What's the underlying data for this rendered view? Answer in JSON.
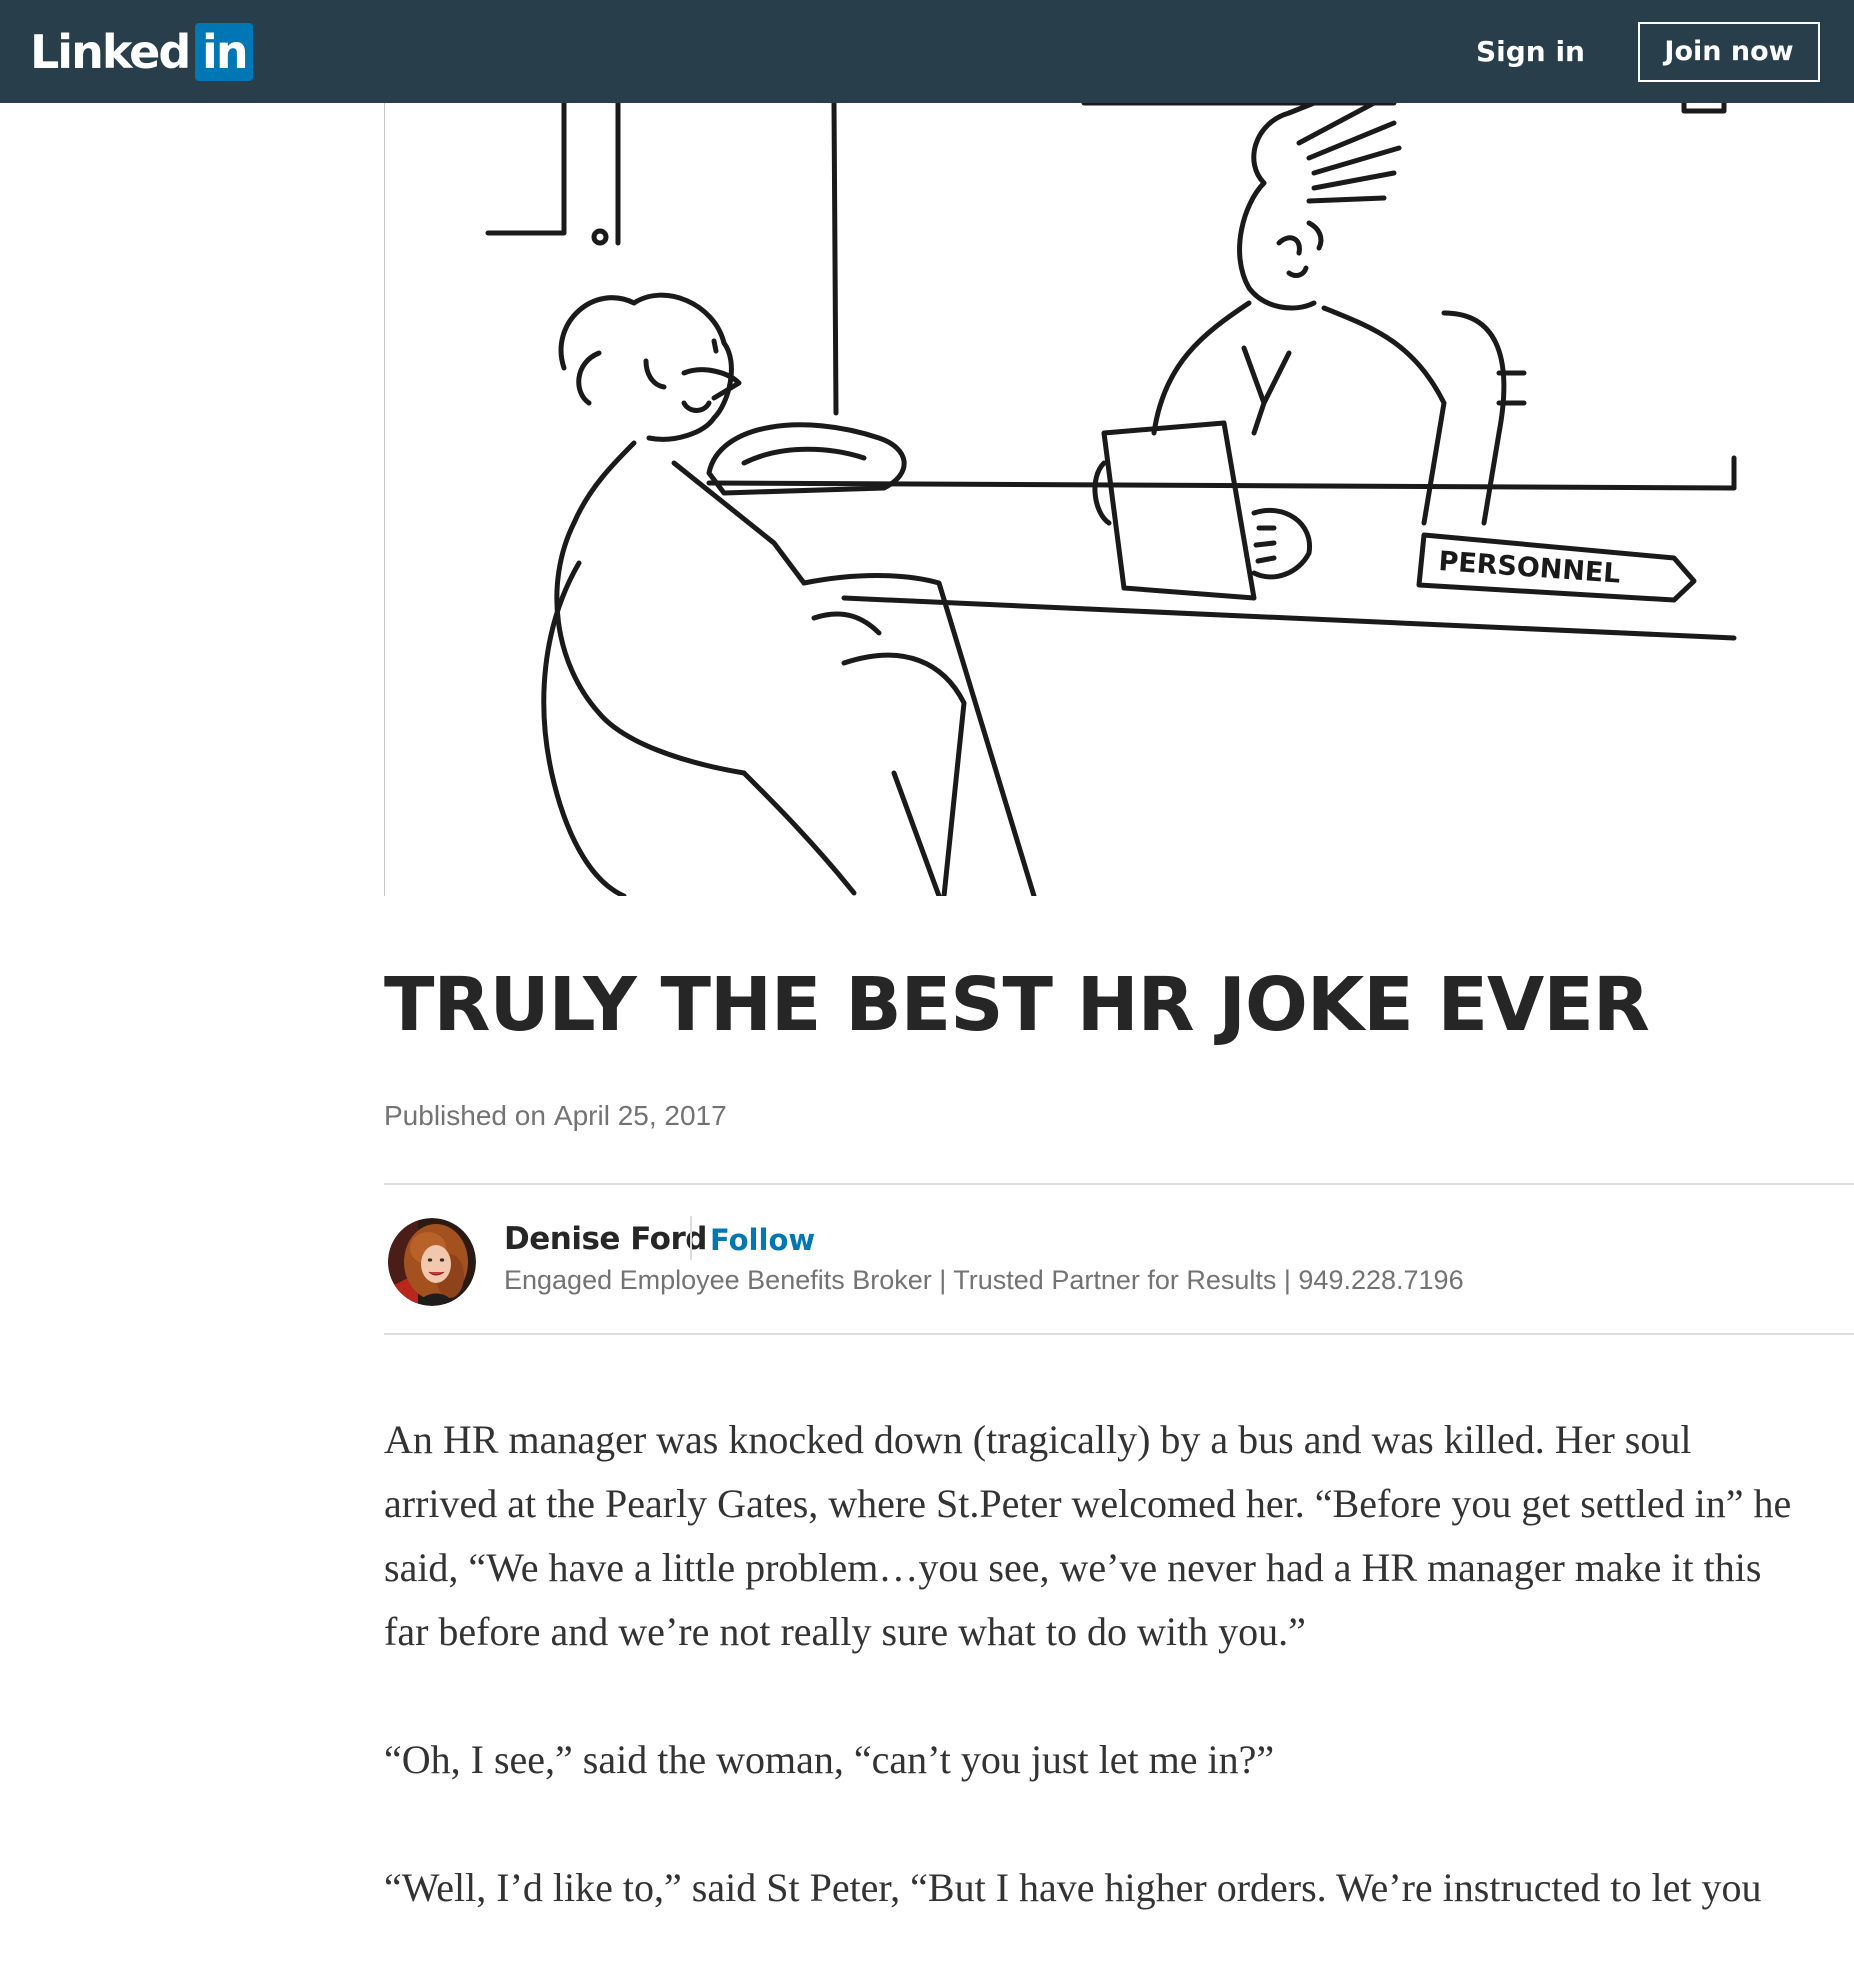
{
  "header": {
    "logo_text": "Linked",
    "logo_box_text": "in",
    "signin_label": "Sign in",
    "join_label": "Join now"
  },
  "hero": {
    "sign_text": "PERSONNEL"
  },
  "article": {
    "title": "TRULY THE BEST HR JOKE EVER",
    "published_label": "Published on",
    "published_date": "April 25, 2017",
    "author": {
      "name": "Denise Ford",
      "follow_label": "Follow",
      "headline": "Engaged Employee Benefits Broker | Trusted Partner for Results | 949.228.7196"
    },
    "paragraphs": [
      {
        "lines": [
          "An HR manager was knocked down (tragically) by a bus and was killed. Her soul",
          "arrived at the Pearly Gates, where St.Peter welcomed her. “Before you get settled in” he",
          "said, “We have a little problem…you see, we’ve never had a HR manager make it this",
          "far before and we’re not really sure what to do with you.”"
        ]
      },
      {
        "lines": [
          "“Oh, I see,” said the woman, “can’t you just let me in?”"
        ]
      },
      {
        "lines": [
          "“Well, I’d like to,” said St Peter, “But I have higher orders. We’re instructed to let you"
        ]
      }
    ]
  },
  "colors": {
    "nav_bg": "#283e4a",
    "brand_blue": "#0077b5",
    "title_text": "#262626",
    "meta_text": "#737373",
    "body_text": "#333333"
  }
}
